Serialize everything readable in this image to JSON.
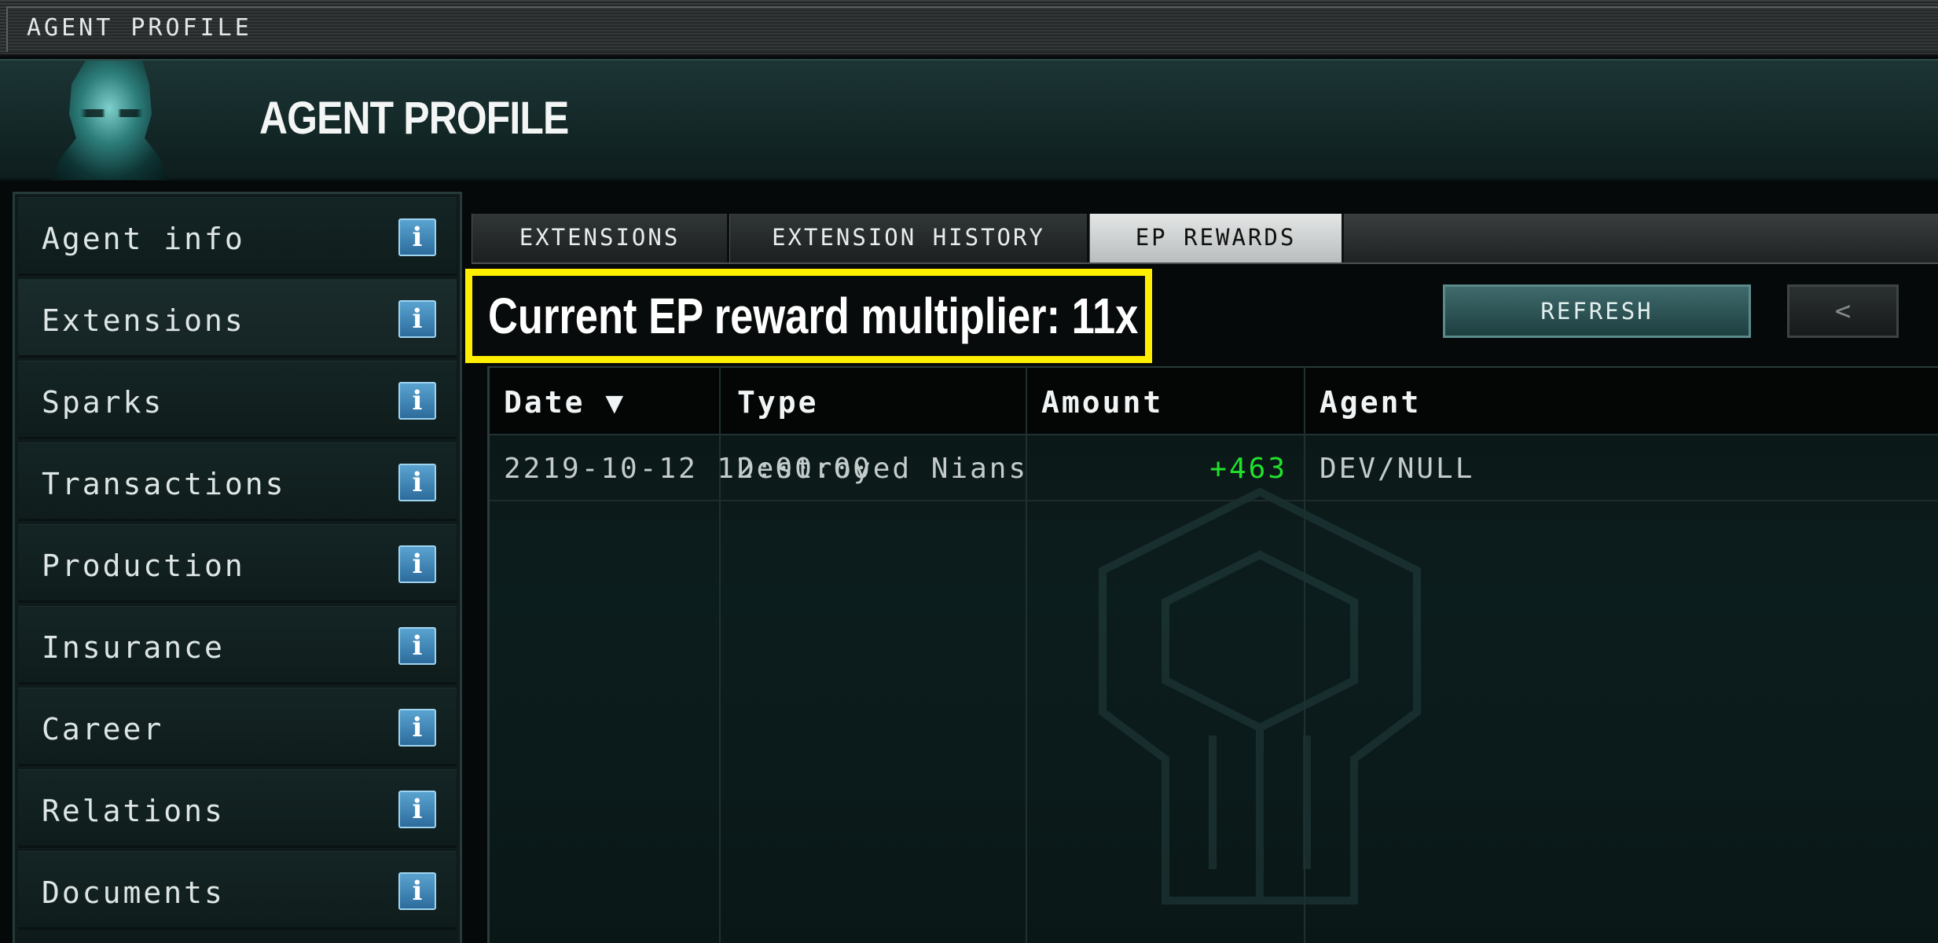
{
  "titlebar": {
    "text": "AGENT PROFILE"
  },
  "header": {
    "title": "AGENT PROFILE"
  },
  "sidebar": {
    "items": [
      {
        "label": "Agent info",
        "icon": "info-icon"
      },
      {
        "label": "Extensions",
        "icon": "info-icon"
      },
      {
        "label": "Sparks",
        "icon": "info-icon"
      },
      {
        "label": "Transactions",
        "icon": "info-icon"
      },
      {
        "label": "Production",
        "icon": "info-icon"
      },
      {
        "label": "Insurance",
        "icon": "info-icon"
      },
      {
        "label": "Career",
        "icon": "info-icon"
      },
      {
        "label": "Relations",
        "icon": "info-icon"
      },
      {
        "label": "Documents",
        "icon": "info-icon"
      }
    ],
    "selected_index": 1,
    "info_glyph": "i"
  },
  "tabs": [
    {
      "label": "EXTENSIONS",
      "active": false
    },
    {
      "label": "EXTENSION HISTORY",
      "active": false
    },
    {
      "label": "EP REWARDS",
      "active": true
    }
  ],
  "rewards": {
    "multiplier_text": "Current EP reward multiplier: 11x",
    "refresh_label": "REFRESH",
    "back_label": "<"
  },
  "table": {
    "columns": [
      "Date ▼",
      "Type",
      "Amount",
      "Agent"
    ],
    "rows": [
      {
        "date": "2219-10-12 12:00:00",
        "type": "Destroyed Nians",
        "amount": "+463",
        "agent": "DEV/NULL"
      }
    ]
  },
  "colors": {
    "highlight": "#ffee00",
    "positive_amount": "#22e12c",
    "info_icon": "#3b7fb3"
  }
}
